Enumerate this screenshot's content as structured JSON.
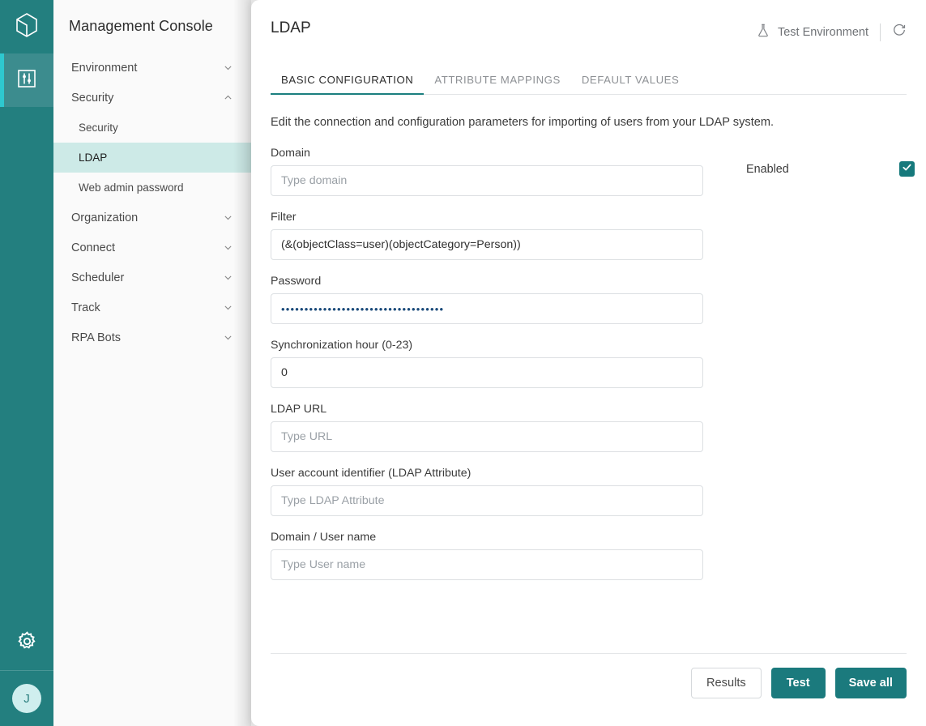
{
  "rail": {
    "logo_icon": "cube-logo-icon",
    "module_icon": "sliders-icon",
    "settings_icon": "gear-icon",
    "avatar_initial": "J"
  },
  "sidebar": {
    "title": "Management Console",
    "items": [
      {
        "label": "Environment",
        "type": "group",
        "expanded": false,
        "icon": "chevron-down-icon"
      },
      {
        "label": "Security",
        "type": "group",
        "expanded": true,
        "icon": "chevron-up-icon"
      },
      {
        "label": "Security",
        "type": "sub",
        "active": false
      },
      {
        "label": "LDAP",
        "type": "sub",
        "active": true
      },
      {
        "label": "Web admin password",
        "type": "sub",
        "active": false
      },
      {
        "label": "Organization",
        "type": "group",
        "expanded": false,
        "icon": "chevron-down-icon"
      },
      {
        "label": "Connect",
        "type": "group",
        "expanded": false,
        "icon": "chevron-down-icon"
      },
      {
        "label": "Scheduler",
        "type": "group",
        "expanded": false,
        "icon": "chevron-down-icon"
      },
      {
        "label": "Track",
        "type": "group",
        "expanded": false,
        "icon": "chevron-down-icon"
      },
      {
        "label": "RPA Bots",
        "type": "group",
        "expanded": false,
        "icon": "chevron-down-icon"
      }
    ]
  },
  "header": {
    "title": "LDAP",
    "environment_label": "Test Environment",
    "environment_icon": "flask-icon",
    "refresh_icon": "refresh-icon"
  },
  "tabs": [
    {
      "label": "BASIC CONFIGURATION",
      "active": true
    },
    {
      "label": "ATTRIBUTE MAPPINGS",
      "active": false
    },
    {
      "label": "DEFAULT VALUES",
      "active": false
    }
  ],
  "main": {
    "intro": "Edit the connection and configuration parameters for importing of users from your LDAP system.",
    "fields": [
      {
        "label": "Domain",
        "value": "",
        "placeholder": "Type domain",
        "name": "domain"
      },
      {
        "label": "Filter",
        "value": "(&(objectClass=user)(objectCategory=Person))",
        "placeholder": "",
        "name": "filter"
      },
      {
        "label": "Password",
        "value": "•••••••••••••••••••••••••••••••••••",
        "placeholder": "",
        "name": "password"
      },
      {
        "label": "Synchronization hour (0-23)",
        "value": "0",
        "placeholder": "",
        "name": "sync-hour"
      },
      {
        "label": "LDAP URL",
        "value": "",
        "placeholder": "Type URL",
        "name": "ldap-url"
      },
      {
        "label": "User account identifier (LDAP Attribute)",
        "value": "",
        "placeholder": "Type LDAP Attribute",
        "name": "user-account-identifier"
      },
      {
        "label": "Domain / User name",
        "value": "",
        "placeholder": "Type User name",
        "name": "domain-user-name"
      }
    ],
    "enabled": {
      "label": "Enabled",
      "checked": true,
      "icon": "check-icon"
    }
  },
  "footer": {
    "results_label": "Results",
    "test_label": "Test",
    "save_label": "Save all"
  },
  "colors": {
    "rail": "#237f7f",
    "rail_active": "#3c8c8e",
    "rail_accent": "#2ec8cf",
    "nav_active": "#cdeae7",
    "primary": "#1b7a7d",
    "checkbox": "#16797c",
    "tab_underline": "#1b7f7f"
  }
}
